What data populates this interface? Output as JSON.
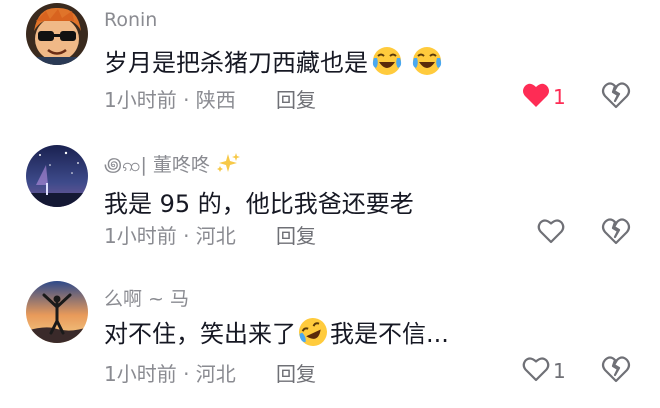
{
  "comments": [
    {
      "avatar": "cartoon-boy-sunglasses-avatar",
      "username": "Ronin",
      "text": "岁月是把杀猪刀西藏也是",
      "emoji": [
        "tears-of-joy-emoji",
        "tears-of-joy-emoji"
      ],
      "meta": "1小时前 · 陕西",
      "reply_label": "回复",
      "like_count": "1",
      "liked": true
    },
    {
      "avatar": "night-sky-avatar",
      "username": "꩜ꩡ| 董咚咚",
      "username_suffix_icon": "sparkles-icon",
      "text": "我是 95 的，他比我爸还要老",
      "meta": "1小时前 · 河北",
      "reply_label": "回复",
      "liked": false
    },
    {
      "avatar": "person-sunset-avatar",
      "username": "么啊 ~ 马",
      "text_before": "对不住，笑出来了",
      "emoji": [
        "rolling-laughing-emoji"
      ],
      "text_after": "我是不信...",
      "meta": "1小时前 · 河北",
      "reply_label": "回复",
      "like_count": "1",
      "liked": false
    }
  ],
  "colors": {
    "like_active": "#fe2c55",
    "secondary_text": "#8a8b91",
    "primary_text": "#161823"
  }
}
